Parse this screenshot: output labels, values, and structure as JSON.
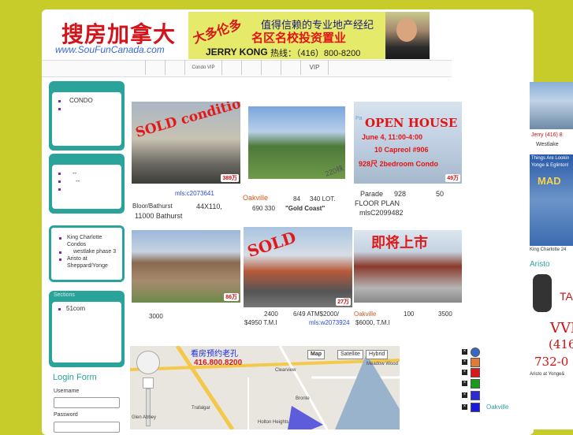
{
  "header": {
    "logo_cn": "搜房加拿大",
    "logo_url": "www.SouFunCanada.com",
    "banner": {
      "slogan_left": "大多伦多",
      "tagline1": "值得信赖的专业地产经纪",
      "tagline2": "名区名校投资置业",
      "agent_name": "JERRY KONG",
      "phone": "热线：（416）800-8200"
    }
  },
  "topnav": {
    "items": [
      "",
      "",
      "",
      "Condo VIP",
      "",
      "",
      "",
      "",
      "VIP"
    ]
  },
  "sidebar": {
    "box1": {
      "items": [
        "",
        "",
        "",
        "CONDO",
        ""
      ]
    },
    "box2": {
      "items": [
        "--",
        "--",
        "",
        "",
        ""
      ]
    },
    "box3": {
      "items": [
        "King Charlotte Condos",
        "westlake phase 3",
        "Aristo at Sheppard/Yonge"
      ]
    },
    "sections": {
      "title": "Sections",
      "items": [
        "",
        "",
        "",
        "",
        "",
        "51com"
      ]
    }
  },
  "login": {
    "title": "Login Form",
    "username_label": "Username",
    "password_label": "Password"
  },
  "listings": [
    {
      "overlay": "SOLD conditionally",
      "badge": "389万",
      "link": "mls:c2073641",
      "line1": "Bloor/Bathurst",
      "line2": "44X110,",
      "line3": "11000  Bathurst"
    },
    {
      "overlay": "220株",
      "place": "Oakville",
      "n1": "84",
      "n2": "340  LOT.",
      "n3": "690  330",
      "n4": "\"Gold Coast\""
    },
    {
      "overlay": "OPEN HOUSE",
      "overlay2": "June 4, 11:00-4:00",
      "overlay3": "10 Capreol #906",
      "overlay4": "928尺 2bedroom Condo",
      "badge": "49万",
      "line1": "Parade",
      "line2": "928",
      "line3": "50",
      "line4": "FLOOR PLAN",
      "line5": "mlsC2099482",
      "extra": "Pa"
    },
    {
      "badge": "86万",
      "line1": "3000"
    },
    {
      "overlay": "SOLD",
      "badge": "27万",
      "line1": "2400",
      "line2": "6/49 ATM$2000/",
      "line3": "$4950 T.M.I",
      "link": "mls:w2073924"
    },
    {
      "overlay": "即将上市",
      "place": "Oakville",
      "line1": "100",
      "line2": "3500",
      "line3": "$6000, T.M.I"
    }
  ],
  "map": {
    "ad_line1": "看房预约老孔",
    "ad_line2": "416.800.8200",
    "types": [
      "Map",
      "Satellite",
      "Hybrid"
    ],
    "labels": [
      "Clearview",
      "Trafalgar",
      "Glen Abbey",
      "Holton Heights",
      "Meadow Wood",
      "Bronte"
    ]
  },
  "legend": {
    "colors": [
      "#3a66c8",
      "#e07a3a",
      "#d41a1a",
      "#1a9a1a",
      "#2a2ad8",
      "#1a1ad8"
    ],
    "last_label": "Oakville"
  },
  "rightcol": {
    "line1": "Jerry (416) 8",
    "line2": "Westlake",
    "line3": "Things Are Lookin",
    "line4": "Yonge & Eglinton!",
    "line5": "MAD",
    "line6": "King Charlotte 24",
    "line7": "Aristo",
    "line8": "TA",
    "line9": "VVI",
    "line10": "(416",
    "line11": "732-0",
    "line12": "Aristo at Yonge&"
  }
}
